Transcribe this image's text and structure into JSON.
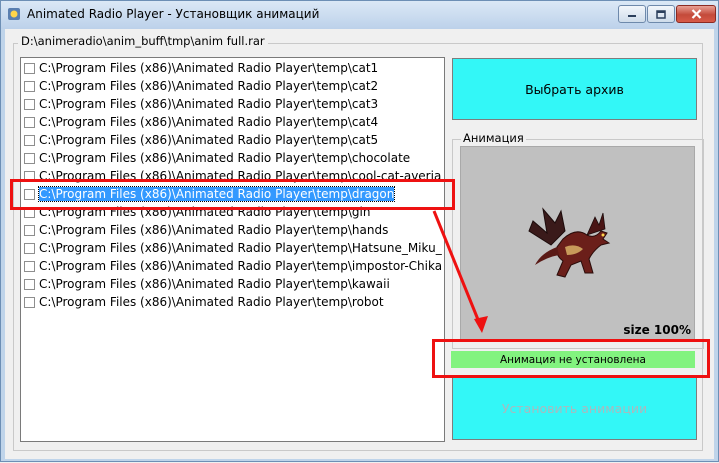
{
  "window": {
    "title": "Animated Radio Player - Установщик анимаций"
  },
  "archive": {
    "path": "D:\\animeradio\\anim_buff\\tmp\\anim full.rar"
  },
  "files": [
    {
      "path": "C:\\Program Files (x86)\\Animated Radio Player\\temp\\cat1",
      "checked": false,
      "selected": false
    },
    {
      "path": "C:\\Program Files (x86)\\Animated Radio Player\\temp\\cat2",
      "checked": false,
      "selected": false
    },
    {
      "path": "C:\\Program Files (x86)\\Animated Radio Player\\temp\\cat3",
      "checked": false,
      "selected": false
    },
    {
      "path": "C:\\Program Files (x86)\\Animated Radio Player\\temp\\cat4",
      "checked": false,
      "selected": false
    },
    {
      "path": "C:\\Program Files (x86)\\Animated Radio Player\\temp\\cat5",
      "checked": false,
      "selected": false
    },
    {
      "path": "C:\\Program Files (x86)\\Animated Radio Player\\temp\\chocolate",
      "checked": false,
      "selected": false
    },
    {
      "path": "C:\\Program Files (x86)\\Animated Radio Player\\temp\\cool-cat-averia",
      "checked": false,
      "selected": false
    },
    {
      "path": "C:\\Program Files (x86)\\Animated Radio Player\\temp\\dragon",
      "checked": false,
      "selected": true
    },
    {
      "path": "C:\\Program Files (x86)\\Animated Radio Player\\temp\\gin",
      "checked": false,
      "selected": false
    },
    {
      "path": "C:\\Program Files (x86)\\Animated Radio Player\\temp\\hands",
      "checked": false,
      "selected": false
    },
    {
      "path": "C:\\Program Files (x86)\\Animated Radio Player\\temp\\Hatsune_Miku_",
      "checked": false,
      "selected": false
    },
    {
      "path": "C:\\Program Files (x86)\\Animated Radio Player\\temp\\impostor-Chika",
      "checked": false,
      "selected": false
    },
    {
      "path": "C:\\Program Files (x86)\\Animated Radio Player\\temp\\kawaii",
      "checked": false,
      "selected": false
    },
    {
      "path": "C:\\Program Files (x86)\\Animated Radio Player\\temp\\robot",
      "checked": false,
      "selected": false
    }
  ],
  "buttons": {
    "choose_archive": "Выбрать архив",
    "install": "Установить анимации"
  },
  "animation": {
    "group_label": "Анимация",
    "size_text": "size 100%",
    "status_text": "Анимация не установлена",
    "status_color": "#82f37f"
  },
  "icons": {
    "window": "app-icon",
    "minimize": "minimize-icon",
    "maximize": "maximize-icon",
    "close": "close-icon",
    "preview": "dragon-image"
  },
  "colors": {
    "button_bg": "#33f7f7",
    "selection": "#3399ff",
    "annotation": "#ee1111"
  }
}
